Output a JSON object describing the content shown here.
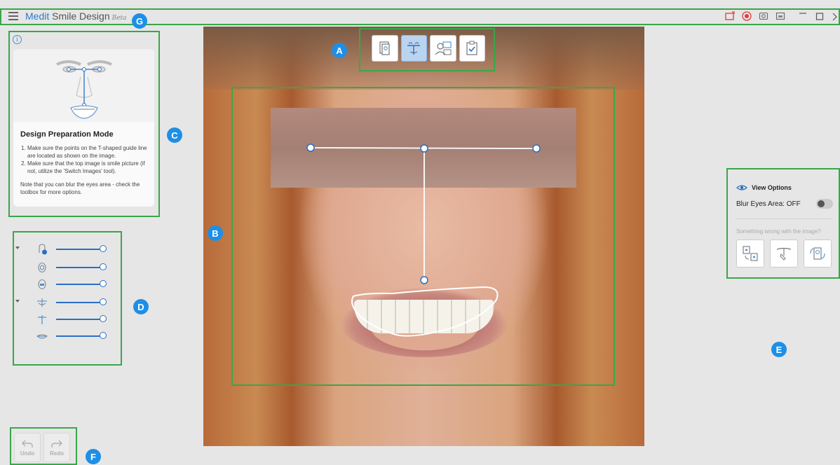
{
  "app": {
    "brand": "Medit",
    "name": "Smile Design",
    "beta": "Beta"
  },
  "markers": {
    "a": "A",
    "b": "B",
    "c": "C",
    "d": "D",
    "e": "E",
    "f": "F",
    "g": "G"
  },
  "info_panel": {
    "title": "Design Preparation Mode",
    "step1": "Make sure the points on the T-shaped guide line are located as shown on the image.",
    "step2": "Make sure that the top image is smile picture (if not, utilize the 'Switch Images' tool).",
    "note": "Note that you can blur the eyes area - check the toolbox for more options."
  },
  "view_options": {
    "title": "View Options",
    "blur_label": "Blur Eyes Area: OFF",
    "blur_on": false,
    "wrong_label": "Something wrong with the image?"
  },
  "history": {
    "undo_label": "Undo",
    "redo_label": "Redo"
  },
  "colors": {
    "accent": "#1e8fe6",
    "highlight_border": "#3aa64a",
    "slider": "#2a6fc2",
    "record": "#e23b3b"
  },
  "icons": {
    "toolbar": [
      "switch-image-icon",
      "t-guide-icon",
      "face-preview-icon",
      "checklist-icon"
    ],
    "titlebar": [
      "screen-capture-icon",
      "record-icon",
      "camera-icon",
      "window-icon",
      "minimize-icon",
      "maximize-icon",
      "close-icon"
    ],
    "sliders": [
      "face-adjust-icon",
      "face-outline-icon",
      "face-inner-icon",
      "smile-frame-icon",
      "t-line-icon",
      "lip-line-icon"
    ]
  }
}
